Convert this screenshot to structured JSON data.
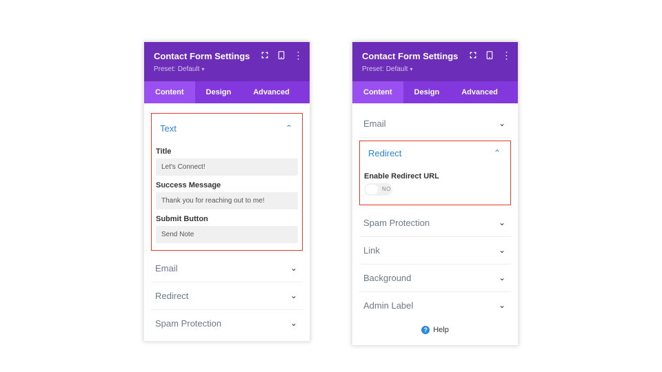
{
  "colors": {
    "header_bg": "#6C2EB9",
    "tabs_bg": "#8238DC",
    "tab_active_bg": "#9A4FF0",
    "accent": "#2b87da",
    "highlight_border": "#e63b2e"
  },
  "header": {
    "title": "Contact Form Settings",
    "preset_label": "Preset:",
    "preset_value": "Default"
  },
  "tabs": {
    "content": "Content",
    "design": "Design",
    "advanced": "Advanced"
  },
  "left": {
    "text_section_title": "Text",
    "fields": {
      "title": {
        "label": "Title",
        "value": "Let's Connect!"
      },
      "success": {
        "label": "Success Message",
        "value": "Thank you for reaching out to me!"
      },
      "submit": {
        "label": "Submit Button",
        "value": "Send Note"
      }
    },
    "collapsed": [
      "Email",
      "Redirect",
      "Spam Protection"
    ]
  },
  "right": {
    "email_title": "Email",
    "redirect": {
      "title": "Redirect",
      "enable_label": "Enable Redirect URL",
      "toggle_text": "NO"
    },
    "collapsed": [
      "Spam Protection",
      "Link",
      "Background",
      "Admin Label"
    ],
    "help": "Help"
  }
}
